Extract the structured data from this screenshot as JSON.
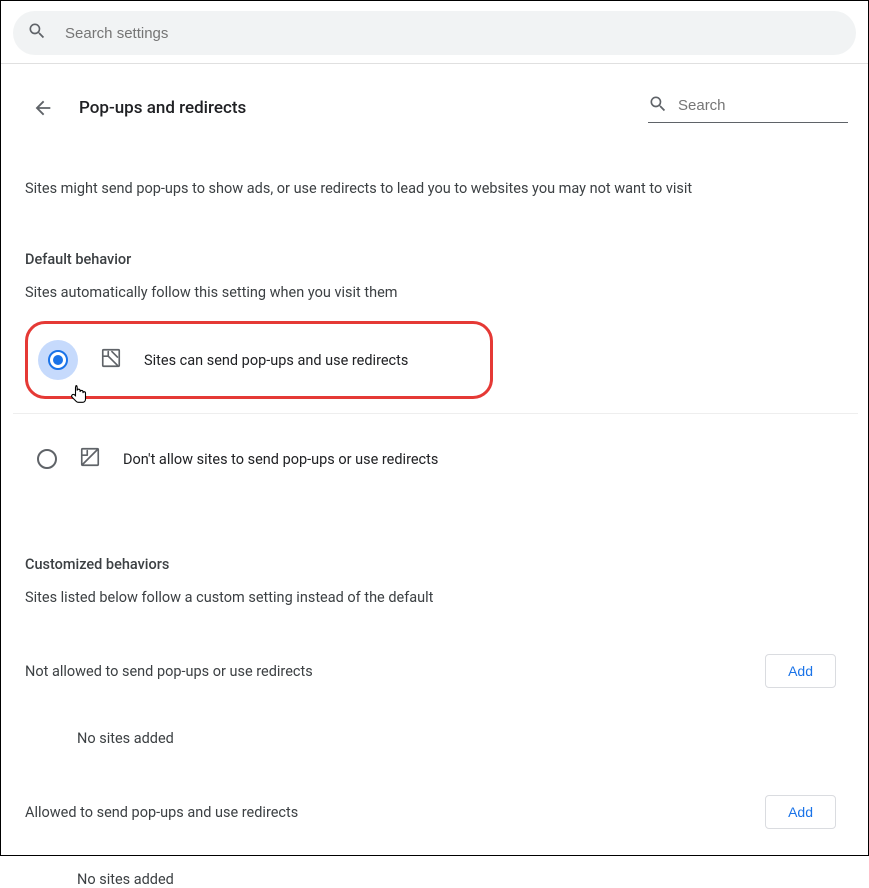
{
  "topSearch": {
    "placeholder": "Search settings"
  },
  "header": {
    "title": "Pop-ups and redirects",
    "searchPlaceholder": "Search"
  },
  "description": "Sites might send pop-ups to show ads, or use redirects to lead you to websites you may not want to visit",
  "defaultBehavior": {
    "title": "Default behavior",
    "subtitle": "Sites automatically follow this setting when you visit them",
    "options": [
      {
        "label": "Sites can send pop-ups and use redirects",
        "selected": true
      },
      {
        "label": "Don't allow sites to send pop-ups or use redirects",
        "selected": false
      }
    ]
  },
  "customized": {
    "title": "Customized behaviors",
    "subtitle": "Sites listed below follow a custom setting instead of the default",
    "sections": [
      {
        "title": "Not allowed to send pop-ups or use redirects",
        "addLabel": "Add",
        "emptyText": "No sites added"
      },
      {
        "title": "Allowed to send pop-ups and use redirects",
        "addLabel": "Add",
        "emptyText": "No sites added"
      }
    ]
  }
}
